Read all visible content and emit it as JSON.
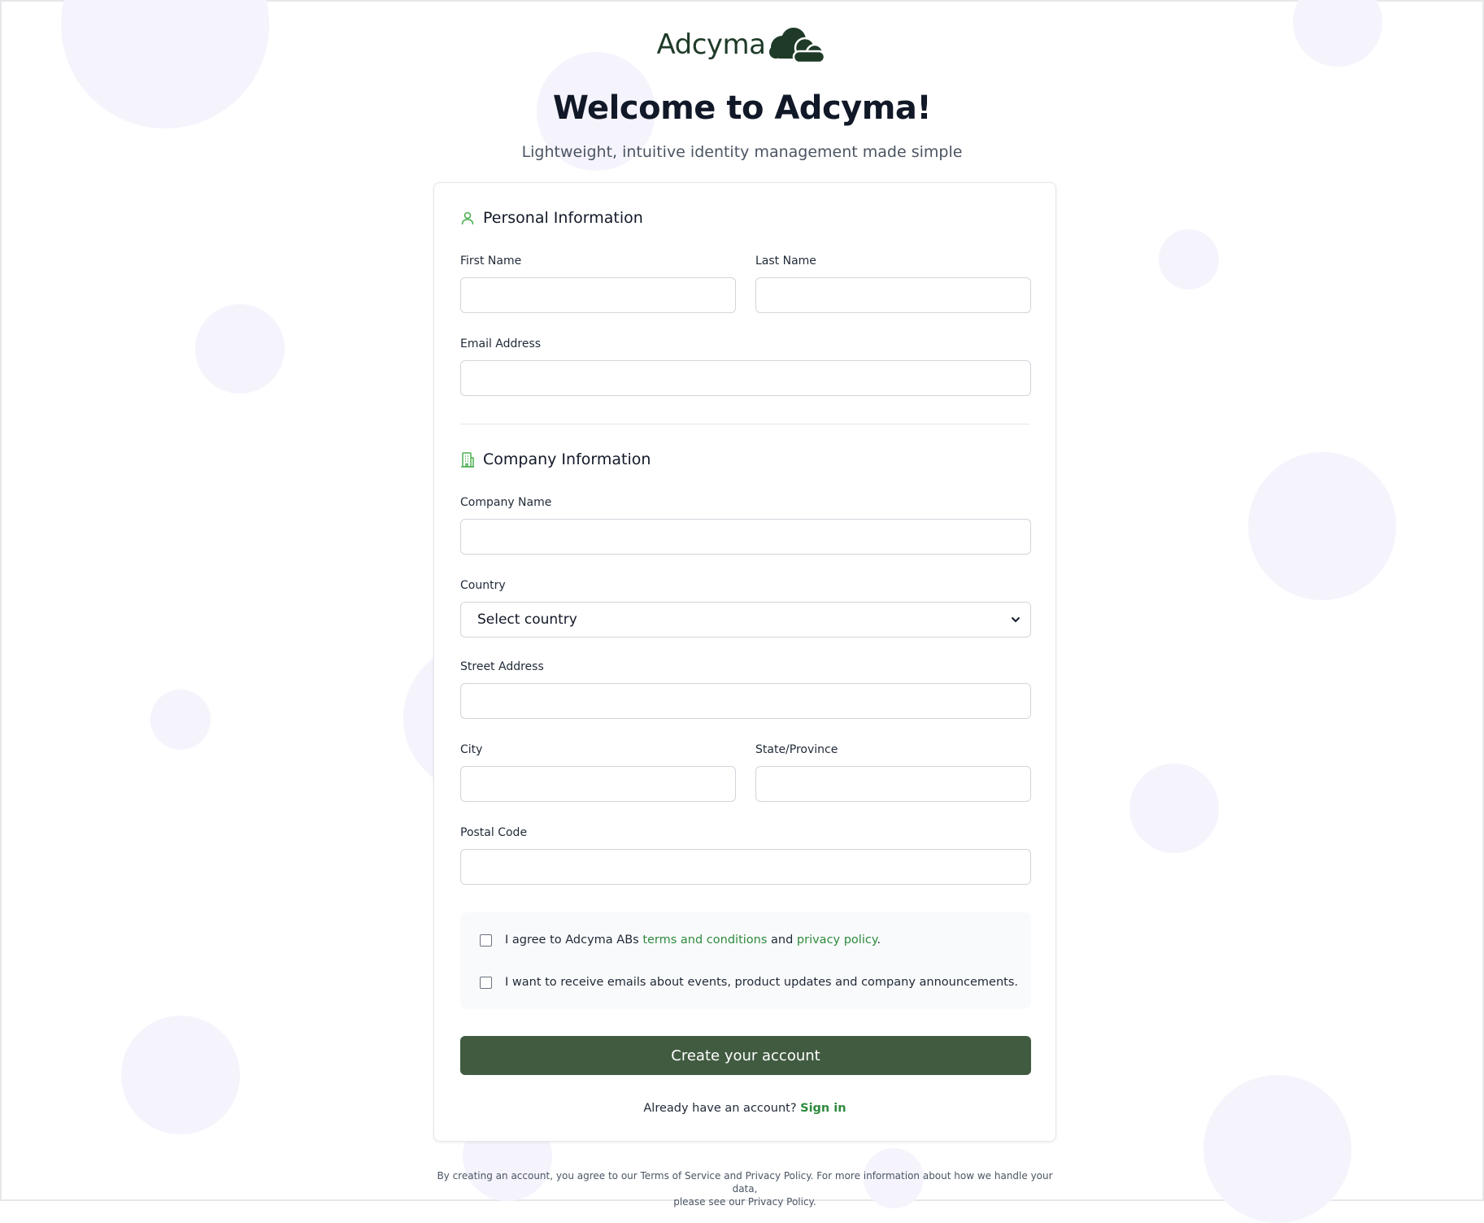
{
  "brand": {
    "name": "Adcyma",
    "color": "#1f3b28"
  },
  "header": {
    "title": "Welcome to Adcyma!",
    "subtitle": "Lightweight, intuitive identity management made simple"
  },
  "personal": {
    "title": "Personal Information",
    "first_name_label": "First Name",
    "last_name_label": "Last Name",
    "email_label": "Email Address"
  },
  "company": {
    "title": "Company Information",
    "company_name_label": "Company Name",
    "country_label": "Country",
    "country_selected": "Select country",
    "street_label": "Street Address",
    "city_label": "City",
    "state_label": "State/Province",
    "postal_label": "Postal Code"
  },
  "consent": {
    "terms_prefix": "I agree to Adcyma ABs ",
    "terms_link": "terms and conditions",
    "terms_and": " and ",
    "privacy_link": "privacy policy",
    "terms_suffix": ".",
    "marketing": "I want to receive emails about events, product updates and company announcements."
  },
  "submit_label": "Create your account",
  "signin": {
    "prompt": "Already have an account? ",
    "link": "Sign in"
  },
  "footer": {
    "line1": "By creating an account, you agree to our Terms of Service and Privacy Policy. For more information about how we handle your data,",
    "line2": "please see our Privacy Policy."
  },
  "colors": {
    "accent": "#2f8a3e",
    "button": "#415b41",
    "bubble": "#f5f3fc"
  }
}
